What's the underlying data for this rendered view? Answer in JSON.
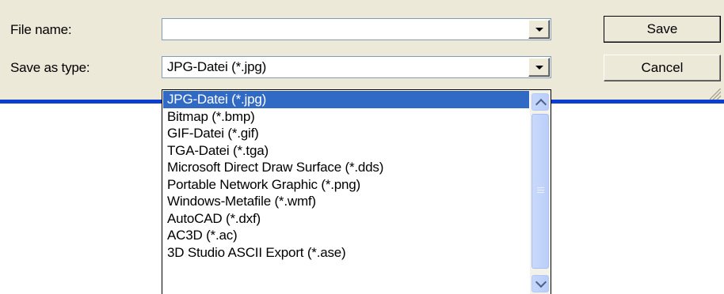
{
  "form": {
    "filename_label": "File name:",
    "filename_value": "",
    "savetype_label": "Save as type:",
    "savetype_value": "JPG-Datei (*.jpg)"
  },
  "buttons": {
    "save_label": "Save",
    "cancel_label": "Cancel"
  },
  "dropdown": {
    "selected_index": 0,
    "options": [
      "JPG-Datei (*.jpg)",
      "Bitmap (*.bmp)",
      "GIF-Datei (*.gif)",
      "TGA-Datei (*.tga)",
      "Microsoft Direct Draw Surface (*.dds)",
      "Portable Network Graphic (*.png)",
      "Windows-Metafile (*.wmf)",
      "AutoCAD (*.dxf)",
      "AC3D (*.ac)",
      "3D Studio ASCII Export (*.ase)"
    ]
  },
  "icons": {
    "dropdown_arrow": "chevron-down-icon",
    "scroll_up": "scroll-up-icon",
    "scroll_down": "scroll-down-icon"
  },
  "colors": {
    "dialog_bg": "#ece9d8",
    "selection": "#316ac5",
    "title_blue": "#0a3fd1"
  }
}
